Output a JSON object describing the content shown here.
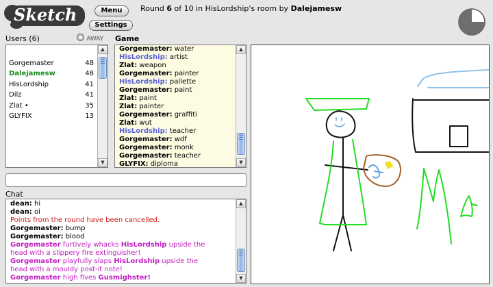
{
  "app": {
    "logo": "Sketch"
  },
  "toolbar": {
    "menu_label": "Menu",
    "settings_label": "Settings"
  },
  "header": {
    "round_prefix": "Round",
    "round_current": "6",
    "round_mid": "of 10 in HisLordship's room by",
    "drawer": "Dalejamesw"
  },
  "timer": {
    "remaining_fraction": 0.75
  },
  "users": {
    "title": "Users (6)",
    "away_label": "AWAY",
    "list": [
      {
        "name": "Gorgemaster",
        "score": "48",
        "color": "#000000",
        "bold": false
      },
      {
        "name": "Dalejamesw",
        "score": "48",
        "color": "#1a8a1a",
        "bold": true
      },
      {
        "name": "HisLordship",
        "score": "41",
        "color": "#000000",
        "bold": false
      },
      {
        "name": "Dilz",
        "score": "41",
        "color": "#000000",
        "bold": false
      },
      {
        "name": "Zlat •",
        "score": "35",
        "color": "#000000",
        "bold": false
      },
      {
        "name": "GLYFIX",
        "score": "13",
        "color": "#000000",
        "bold": false
      }
    ]
  },
  "game": {
    "title": "Game",
    "lines": [
      {
        "user": "Gorgemaster:",
        "text": "water",
        "user_color": "#000000"
      },
      {
        "user": "HisLordship:",
        "text": "artist",
        "user_color": "#5a62d6"
      },
      {
        "user": "Zlat:",
        "text": "weapon",
        "user_color": "#000000"
      },
      {
        "user": "Gorgemaster:",
        "text": "painter",
        "user_color": "#000000"
      },
      {
        "user": "HisLordship:",
        "text": "pallette",
        "user_color": "#5a62d6"
      },
      {
        "user": "Gorgemaster:",
        "text": "paint",
        "user_color": "#000000"
      },
      {
        "user": "Zlat:",
        "text": "paint",
        "user_color": "#000000"
      },
      {
        "user": "Zlat:",
        "text": "painter",
        "user_color": "#000000"
      },
      {
        "user": "Gorgemaster:",
        "text": "graffiti",
        "user_color": "#000000"
      },
      {
        "user": "Zlat:",
        "text": "wut",
        "user_color": "#000000"
      },
      {
        "user": "HisLordship:",
        "text": "teacher",
        "user_color": "#5a62d6"
      },
      {
        "user": "Gorgemaster:",
        "text": "wdf",
        "user_color": "#000000"
      },
      {
        "user": "Gorgemaster:",
        "text": "monk",
        "user_color": "#000000"
      },
      {
        "user": "Gorgemaster:",
        "text": "teacher",
        "user_color": "#000000"
      },
      {
        "user": "GLYFIX:",
        "text": "diploma",
        "user_color": "#000000"
      }
    ]
  },
  "input": {
    "value": ""
  },
  "chat": {
    "title": "Chat",
    "messages": [
      {
        "kind": "msg",
        "user": "dean:",
        "text": "hi"
      },
      {
        "kind": "msg",
        "user": "dean:",
        "text": "oi"
      },
      {
        "kind": "system",
        "text": "Points from the round have been cancelled."
      },
      {
        "kind": "msg",
        "user": "Gorgemaster:",
        "text": "bump"
      },
      {
        "kind": "msg",
        "user": "Gorgemaster:",
        "text": "blood"
      },
      {
        "kind": "action",
        "lines": [
          [
            {
              "t": "Gorgemaster",
              "b": true
            },
            {
              "t": " furtively whacks ",
              "b": false
            },
            {
              "t": "HisLordship",
              "b": true
            },
            {
              "t": " upside the",
              "b": false
            }
          ],
          [
            {
              "t": "head with a slippery fire extinguisher!",
              "b": false
            }
          ]
        ]
      },
      {
        "kind": "action",
        "lines": [
          [
            {
              "t": "Gorgemaster",
              "b": true
            },
            {
              "t": " playfully slaps ",
              "b": false
            },
            {
              "t": "HisLordship",
              "b": true
            },
            {
              "t": " upside the",
              "b": false
            }
          ],
          [
            {
              "t": "head with a mouldy post-it note!",
              "b": false
            }
          ]
        ]
      },
      {
        "kind": "action",
        "lines": [
          [
            {
              "t": "Gorgemaster",
              "b": true
            },
            {
              "t": " high fives ",
              "b": false
            },
            {
              "t": "Gusmighster!",
              "b": true
            }
          ]
        ]
      }
    ]
  },
  "colors": {
    "game_bg": "#fefbe3",
    "system": "#cc1b1b",
    "action": "#c21ec2",
    "canvas_bg": "#ffffff"
  }
}
